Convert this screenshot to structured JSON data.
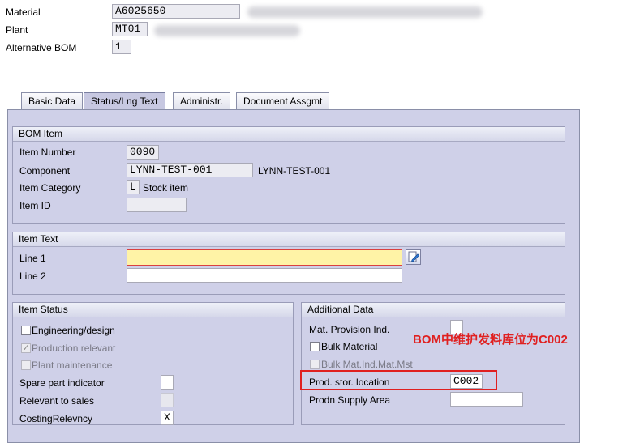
{
  "header": {
    "material_label": "Material",
    "material_value": "A6025650",
    "plant_label": "Plant",
    "plant_value": "MT01",
    "alt_bom_label": "Alternative BOM",
    "alt_bom_value": "1"
  },
  "tabs": [
    {
      "label": "Basic Data",
      "active": false
    },
    {
      "label": "Status/Lng Text",
      "active": true
    },
    {
      "label": "Administr.",
      "active": false
    },
    {
      "label": "Document Assgmt",
      "active": false
    }
  ],
  "bom_item": {
    "title": "BOM Item",
    "item_number_label": "Item Number",
    "item_number_value": "0090",
    "component_label": "Component",
    "component_value": "LYNN-TEST-001",
    "component_desc": "LYNN-TEST-001",
    "item_category_label": "Item Category",
    "item_category_value": "L",
    "item_category_desc": "Stock item",
    "item_id_label": "Item ID",
    "item_id_value": ""
  },
  "item_text": {
    "title": "Item Text",
    "line1_label": "Line 1",
    "line1_value": "",
    "line2_label": "Line 2",
    "line2_value": ""
  },
  "item_status": {
    "title": "Item Status",
    "engineering_label": "Engineering/design",
    "engineering_checked": false,
    "production_label": "Production relevant",
    "production_checked": true,
    "plant_maint_label": "Plant maintenance",
    "plant_maint_checked": false,
    "spare_part_label": "Spare part indicator",
    "spare_part_value": "",
    "rel_sales_label": "Relevant to sales",
    "rel_sales_value": "",
    "costing_label": "CostingRelevncy",
    "costing_value": "X"
  },
  "additional_data": {
    "title": "Additional Data",
    "mat_provision_label": "Mat. Provision Ind.",
    "mat_provision_value": "",
    "bulk_material_label": "Bulk Material",
    "bulk_material_checked": false,
    "bulk_mat_ind_label": "Bulk Mat.Ind.Mat.Mst",
    "bulk_mat_ind_checked": false,
    "prod_stor_label": "Prod. stor. location",
    "prod_stor_value": "C002",
    "prodn_supply_label": "Prodn Supply Area",
    "prodn_supply_value": ""
  },
  "annotation": {
    "text": "BOM中维护发料库位为C002",
    "color": "#e02020"
  },
  "colors": {
    "panel_bg": "#cfd0e8",
    "highlight_field": "#fff3a6",
    "annotation_box": "#e02020"
  }
}
